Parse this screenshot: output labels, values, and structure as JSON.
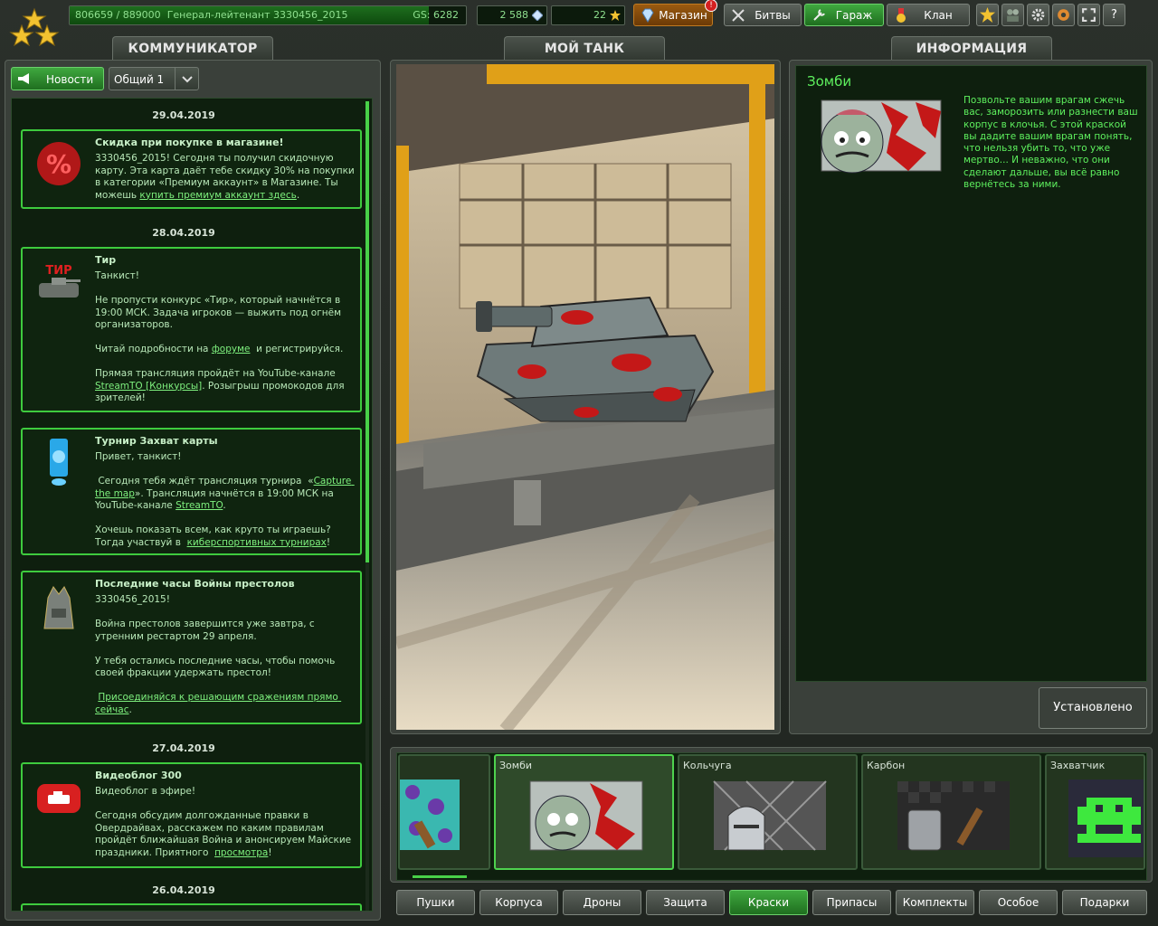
{
  "topbar": {
    "rank_icon": "rank-stars-icon",
    "xp_text": "806659 / 889000",
    "rank_name": "Генерал-лейтенант 3330456_2015",
    "gs": "GS: 6282",
    "xp_fraction": 0.907,
    "crystals": "2 588",
    "stars": "22",
    "shop": "Магазин",
    "shop_badge": "!",
    "battles": "Битвы",
    "garage": "Гараж",
    "clan": "Клан",
    "help": "?"
  },
  "communicator": {
    "title": "КОММУНИКАТОР",
    "news_button": "Новости",
    "channel": "Общий 1",
    "dates": [
      "29.04.2019",
      "28.04.2019",
      "27.04.2019",
      "26.04.2019"
    ],
    "cards": [
      {
        "title": "Скидка при покупке в магазине!",
        "body_a": "3330456_2015! Сегодня ты получил скидочную карту. Эта карта даёт тебе скидку 30% на покупки в категории «Премиум аккаунт» в Магазине. Ты можешь ",
        "link": "купить премиум аккаунт здесь",
        "body_b": "."
      },
      {
        "title": "Тир",
        "body_a": "Танкист!\n\nНе пропусти конкурс «Тир», который начнётся в 19:00 МСК. Задача игроков — выжить под огнём организаторов.\n\nЧитай подробности на ",
        "link": "форуме",
        "body_b": "  и регистрируйся.\n\nПрямая трансляция пройдёт на YouTube-канале ",
        "link2": "StreamTO [Конкурсы]",
        "body_c": ". Розыгрыш промокодов для зрителей!"
      },
      {
        "title": "Турнир Захват карты",
        "body_a": "Привет, танкист!\n\n Сегодня тебя ждёт трансляция турнира  «",
        "link": "Capture the map",
        "body_b": "». Трансляция начнётся в 19:00 МСК на YouTube-канале ",
        "link2": "StreamTO",
        "body_c": ".\n\nХочешь показать всем, как круто ты играешь? Тогда участвуй в  ",
        "link3": "киберспортивных турнирах",
        "body_d": "!"
      },
      {
        "title": "Последние часы Войны престолов",
        "body_a": "3330456_2015!\n\nВойна престолов завершится уже завтра, с утренним рестартом 29 апреля.\n\nУ тебя остались последние часы, чтобы помочь своей фракции удержать престол!\n\n ",
        "link": "Присоединяйся к решающим сражениям прямо сейчас",
        "body_b": "."
      },
      {
        "title": "Видеоблог 300",
        "body_a": "Видеоблог в эфире!\n\nСегодня обсудим долгожданные правки в Овердрайвах, расскажем по каким правилам пройдёт ближайшая Война и анонсируем Майские праздники. Приятного  ",
        "link": "просмотра",
        "body_b": "!"
      }
    ]
  },
  "mytank": {
    "title": "МОЙ ТАНК"
  },
  "info": {
    "title": "ИНФОРМАЦИЯ",
    "item_name": "Зомби",
    "description": "Позвольте вашим врагам сжечь вас, заморозить или разнести ваш корпус в клочья. С этой краской вы дадите вашим врагам понять, что нельзя убить то, что уже мертво... И неважно, что они сделают дальше, вы всё равно вернётесь за ними.",
    "status_button": "Установлено"
  },
  "garage_items": [
    {
      "name": "",
      "icon": "paint-brush-icon"
    },
    {
      "name": "Зомби",
      "icon": "zombie-paint-icon"
    },
    {
      "name": "Кольчуга",
      "icon": "chainmail-paint-icon"
    },
    {
      "name": "Карбон",
      "icon": "carbon-paint-icon"
    },
    {
      "name": "Захватчик",
      "icon": "invader-paint-icon"
    }
  ],
  "categories": [
    "Пушки",
    "Корпуса",
    "Дроны",
    "Защита",
    "Краски",
    "Припасы",
    "Комплекты",
    "Особое",
    "Подарки"
  ],
  "active_category": "Краски",
  "colors": {
    "accent": "#3ecb3e",
    "shop": "#9a5a10",
    "active": "#2f8f2f"
  }
}
